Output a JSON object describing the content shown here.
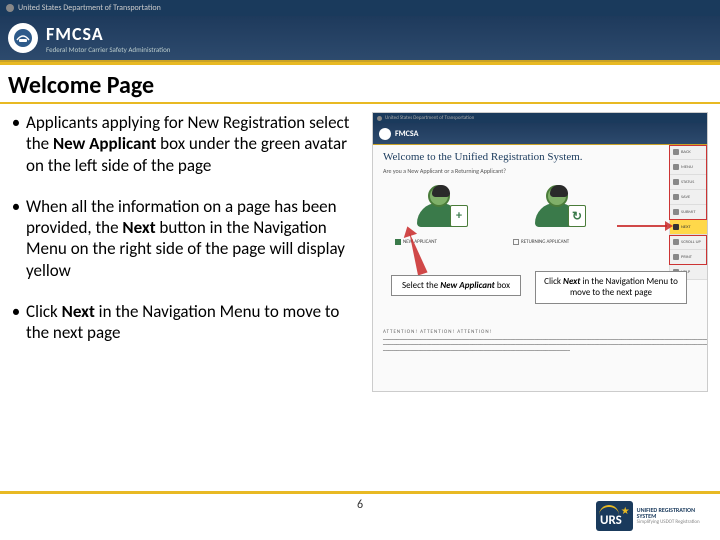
{
  "header": {
    "dept": "United States Department of Transportation",
    "agency": "FMCSA",
    "agency_sub": "Federal Motor Carrier Safety Administration"
  },
  "title": "Welcome Page",
  "bullets": [
    {
      "pre": "Applicants applying for New Registration select the ",
      "bold": "New Applicant",
      "post": " box under the green avatar on the left side of the page"
    },
    {
      "pre": "When all the information on a page has been provided, the ",
      "bold": "Next",
      "post": " button in the Navigation Menu on the right side of the page will display yellow"
    },
    {
      "pre": "Click ",
      "bold": "Next",
      "post": " in the Navigation Menu to move to the next page"
    }
  ],
  "screenshot": {
    "welcome": "Welcome to the Unified Registration System.",
    "question": "Are you a New Applicant or a Returning Applicant?",
    "new_label": "NEW APPLICANT",
    "ret_label": "RETURNING APPLICANT",
    "nav": [
      "BACK",
      "MENU",
      "STATUS",
      "SAVE",
      "SUBMIT",
      "NEXT",
      "SCROLL UP",
      "PRINT",
      "HELP"
    ],
    "callout1_pre": "Select the ",
    "callout1_bold": "New Applicant",
    "callout1_post": " box",
    "callout2_pre": "Click ",
    "callout2_bold": "Next",
    "callout2_post": " in the Navigation Menu to move to the next page",
    "attention_title": "ATTENTION! ATTENTION! ATTENTION!"
  },
  "page_number": "6",
  "footer": {
    "urs": "URS",
    "urs_full": "UNIFIED REGISTRATION SYSTEM",
    "urs_sub": "Simplifying USDOT Registration"
  }
}
